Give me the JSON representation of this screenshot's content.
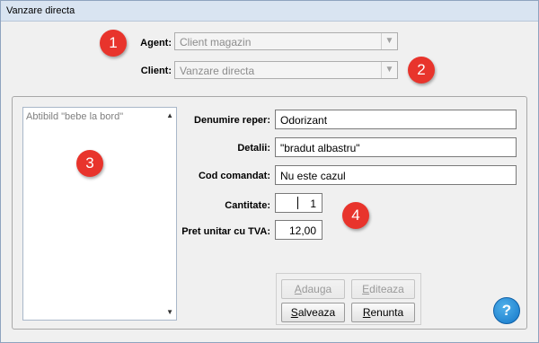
{
  "window": {
    "title": "Vanzare directa"
  },
  "agent": {
    "label": "Agent:",
    "value": "Client magazin"
  },
  "client": {
    "label": "Client:",
    "value": "Vanzare directa"
  },
  "list": {
    "items": [
      "Abtibild \"bebe la bord\""
    ]
  },
  "form": {
    "denumire_label": "Denumire reper:",
    "denumire_value": "Odorizant",
    "detalii_label": "Detalii:",
    "detalii_value": "\"bradut albastru\"",
    "cod_label": "Cod comandat:",
    "cod_value": "Nu este cazul",
    "cantitate_label": "Cantitate:",
    "cantitate_value": "1",
    "pret_label": "Pret unitar cu TVA:",
    "pret_value": "12,00"
  },
  "buttons": {
    "adauga_first": "A",
    "adauga_rest": "dauga",
    "editeaza_first": "E",
    "editeaza_rest": "diteaza",
    "salveaza_first": "S",
    "salveaza_rest": "alveaza",
    "renunta_first": "R",
    "renunta_rest": "enunta"
  },
  "badges": [
    "1",
    "2",
    "3",
    "4"
  ],
  "help": "?",
  "icons": {
    "dropdown": "chevron-down-icon",
    "scroll_up": "scroll-up-icon",
    "scroll_down": "scroll-down-icon",
    "help": "help-icon"
  },
  "colors": {
    "badge": "#e8342c",
    "help": "#1577c9",
    "titlebar": "#d9e4f1"
  }
}
